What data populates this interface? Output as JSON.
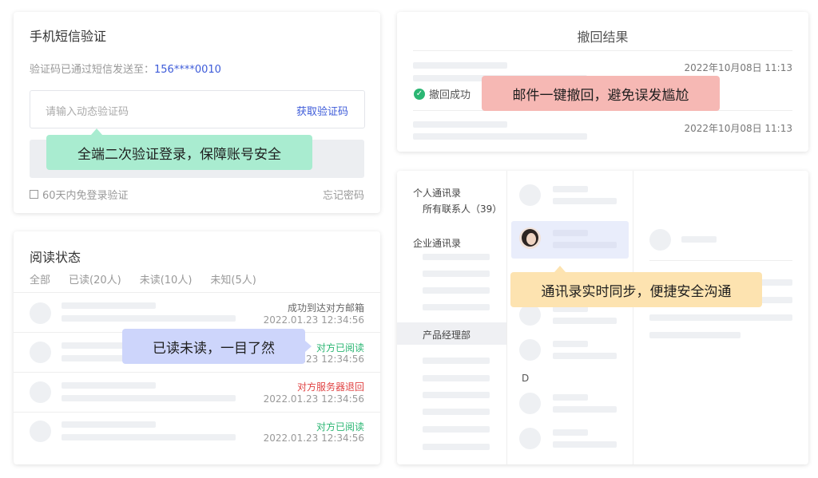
{
  "sms": {
    "title": "手机短信验证",
    "sent_prefix": "验证码已通过短信发送至：",
    "phone": "156****0010",
    "input_placeholder": "请输入动态验证码",
    "get_code": "获取验证码",
    "callout": "全端二次验证登录，保障账号安全",
    "remember": "60天内免登录验证",
    "forgot": "忘记密码",
    "callout_color": "#a9ecd0"
  },
  "recall": {
    "title": "撤回结果",
    "rows": [
      {
        "date": "2022年10月08日 11:13"
      },
      {
        "status": "撤回成功"
      },
      {
        "date": "2022年10月08日 11:13"
      }
    ],
    "callout": "邮件一键撤回，避免误发尴尬",
    "callout_color": "#f6b8b4"
  },
  "read": {
    "title": "阅读状态",
    "tabs": [
      "全部",
      "已读(20人)",
      "未读(10人)",
      "未知(5人)"
    ],
    "rows": [
      {
        "status": "成功到达对方邮箱",
        "color": "#666666",
        "time": "2022.01.23 12:34:56"
      },
      {
        "status": "对方已阅读",
        "color": "#2bb673",
        "time": "2022.01.23 12:34:56"
      },
      {
        "status": "对方服务器退回",
        "color": "#e04343",
        "time": "2022.01.23 12:34:56"
      },
      {
        "status": "对方已阅读",
        "color": "#2bb673",
        "time": "2022.01.23 12:34:56"
      }
    ],
    "callout": "已读未读，一目了然",
    "callout_color": "#cdd5fb"
  },
  "contacts": {
    "personal": "个人通讯录",
    "all_contacts": "所有联系人（39）",
    "enterprise": "企业通讯录",
    "department": "产品经理部",
    "letter": "D",
    "callout": "通讯录实时同步，便捷安全沟通",
    "callout_color": "#fde3b0"
  },
  "colors": {
    "link": "#3d5bd9",
    "success": "#2bb673",
    "danger": "#e04343"
  }
}
